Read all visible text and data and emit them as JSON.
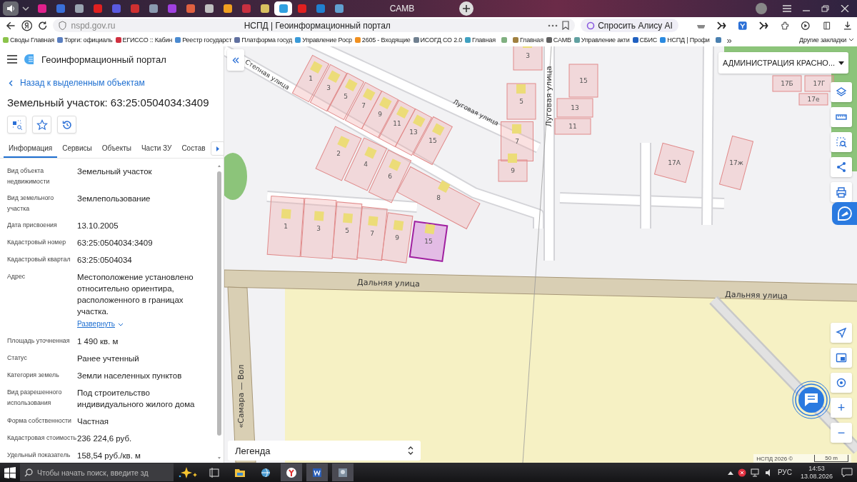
{
  "browser": {
    "tabs": [
      {
        "color": "#e0208c",
        "selected": false
      },
      {
        "color": "#3a6fd8",
        "selected": false
      },
      {
        "color": "#9aa4b0",
        "selected": false
      },
      {
        "color": "#e02020",
        "selected": false
      },
      {
        "color": "#5a5ae0",
        "selected": false
      },
      {
        "color": "#d03030",
        "selected": false
      },
      {
        "color": "#8a9ab0",
        "selected": false
      },
      {
        "color": "#a040e0",
        "selected": false
      },
      {
        "color": "#e06040",
        "selected": false
      },
      {
        "color": "#c0c0c0",
        "selected": false
      },
      {
        "color": "#f0a020",
        "selected": false
      },
      {
        "color": "#c83040",
        "selected": false
      },
      {
        "color": "#d8c060",
        "selected": false
      },
      {
        "color": "#30a0e0",
        "selected": true
      },
      {
        "color": "#e02020",
        "selected": false
      },
      {
        "color": "#2080d0",
        "selected": false
      },
      {
        "color": "#60a0d0",
        "selected": false
      },
      {
        "title": "САМВ",
        "selected": false
      }
    ],
    "url": "nspd.gov.ru",
    "page_title": "НСПД | Геоинформационный портал",
    "alice": "Спросить Алису AI",
    "bookmarks": [
      {
        "title": "Своды Главная",
        "color": "#8bc34a"
      },
      {
        "title": "Торги: официаль",
        "color": "#5a7fc0"
      },
      {
        "title": "ЕГИССО :: Кабин",
        "color": "#d03040"
      },
      {
        "title": "Реестр государст",
        "color": "#4a8ad0"
      },
      {
        "title": "Платформа госуд",
        "color": "#6070a0"
      },
      {
        "title": "Управление Роср",
        "color": "#3a9ad8"
      },
      {
        "title": "2605 - Входящие",
        "color": "#f09020"
      },
      {
        "title": "ИСОГД СО 2.0",
        "color": "#708090"
      },
      {
        "title": "Главная",
        "color": "#40a0c0"
      },
      {
        "color": "#80b080"
      },
      {
        "title": "Главная",
        "color": "#a08040"
      },
      {
        "title": "САМВ",
        "color": "#606060"
      },
      {
        "title": "Управление акти",
        "color": "#60a0a0"
      },
      {
        "title": "СБИС",
        "color": "#2060c0"
      },
      {
        "title": "НСПД | Профи",
        "color": "#2a8ae0"
      },
      {
        "color": "#4a80b0"
      }
    ],
    "more": "»",
    "other": "Другие закладки"
  },
  "panel": {
    "app_title": "Геоинформационный портал",
    "back": "Назад к выделенным объектам",
    "heading": "Земельный участок: 63:25:0504034:3409",
    "tabs": [
      {
        "label": "Информация",
        "selected": true
      },
      {
        "label": "Сервисы",
        "selected": false
      },
      {
        "label": "Объекты",
        "selected": false
      },
      {
        "label": "Части ЗУ",
        "selected": false
      },
      {
        "label": "Состав",
        "selected": false
      }
    ],
    "properties": [
      {
        "label": "Вид объекта недвижимости",
        "value": "Земельный участок"
      },
      {
        "label": "Вид земельного участка",
        "value": "Землепользование"
      },
      {
        "label": "Дата присвоения",
        "value": "13.10.2005"
      },
      {
        "label": "Кадастровый номер",
        "value": "63:25:0504034:3409"
      },
      {
        "label": "Кадастровый квартал",
        "value": "63:25:0504034"
      },
      {
        "label": "Адрес",
        "value": "Местоположение установлено относительно ориентира, расположенного в границах участка.",
        "link": "Развернуть"
      },
      {
        "label": "Площадь уточненная",
        "value": "1 490 кв. м"
      },
      {
        "label": "Статус",
        "value": "Ранее учтенный"
      },
      {
        "label": "Категория земель",
        "value": "Земли населенных пунктов"
      },
      {
        "label": "Вид разрешенного использования",
        "value": "Под строительство индивидуального жилого дома"
      },
      {
        "label": "Форма собственности",
        "value": "Частная"
      },
      {
        "label": "Кадастровая стоимость",
        "value": "236 224,6 руб."
      },
      {
        "label": "Удельный показатель",
        "value": "158,54 руб./кв. м"
      }
    ]
  },
  "map": {
    "admin_select": "АДМИНИСТРАЦИЯ КРАСНО...",
    "streets": [
      "Луговая улица",
      "Степная улица",
      "Луговая улица",
      "Дальняя улица",
      "Дальняя улица",
      "«Самара — Вол"
    ],
    "parcels": [
      {
        "label": "1",
        "selected": false
      },
      {
        "label": "3",
        "selected": false
      },
      {
        "label": "5",
        "selected": false
      },
      {
        "label": "7",
        "selected": false
      },
      {
        "label": "9",
        "selected": false
      },
      {
        "label": "15",
        "selected": true
      },
      {
        "label": "2",
        "selected": false
      },
      {
        "label": "4",
        "selected": false
      },
      {
        "label": "6",
        "selected": false
      },
      {
        "label": "8",
        "selected": false
      },
      {
        "label": "1",
        "selected": false
      },
      {
        "label": "3",
        "selected": false
      },
      {
        "label": "5",
        "selected": false
      },
      {
        "label": "7",
        "selected": false
      },
      {
        "label": "9",
        "selected": false
      },
      {
        "label": "11",
        "selected": false
      },
      {
        "label": "13",
        "selected": false
      },
      {
        "label": "15",
        "selected": false
      },
      {
        "label": "3",
        "selected": false
      },
      {
        "label": "5",
        "selected": false
      },
      {
        "label": "7",
        "selected": false
      },
      {
        "label": "9",
        "selected": false
      },
      {
        "label": "15",
        "selected": false
      },
      {
        "label": "13",
        "selected": false
      },
      {
        "label": "11",
        "selected": false
      },
      {
        "label": "17А",
        "selected": false
      },
      {
        "label": "17ж",
        "selected": false
      },
      {
        "label": "17Б",
        "selected": false
      },
      {
        "label": "17Г",
        "selected": false
      },
      {
        "label": "17е",
        "selected": false
      }
    ],
    "zoom_in": "+",
    "zoom_out": "−",
    "legend": "Легенда",
    "attribution": "НСПД 2026 ©",
    "scale": "50 m"
  },
  "taskbar": {
    "search_placeholder": "Чтобы начать поиск, введите зд",
    "language": "РУС",
    "time": "14:53",
    "date": "13.08.2026"
  }
}
